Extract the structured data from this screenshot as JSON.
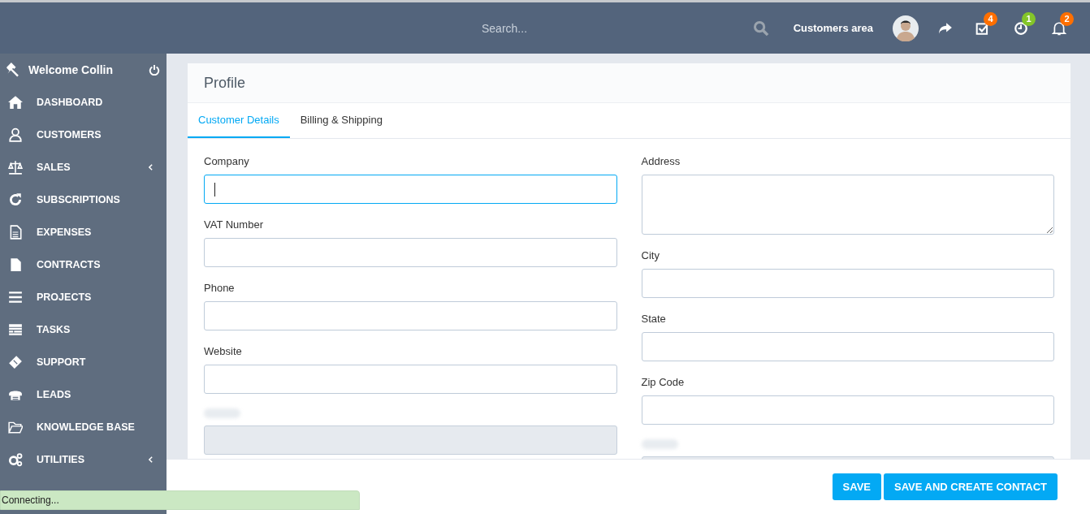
{
  "header": {
    "search": {
      "placeholder": "Search..."
    },
    "customers_area": "Customers area",
    "notifications": [
      {
        "kind": "tasks",
        "count": "4",
        "color": "#ff6f00"
      },
      {
        "kind": "clock",
        "count": "1",
        "color": "#84c529"
      },
      {
        "kind": "bell",
        "count": "2",
        "color": "#ff6f00"
      }
    ]
  },
  "sidebar": {
    "welcome": "Welcome Collin",
    "items": [
      {
        "label": "DASHBOARD",
        "kind": "home",
        "submenu": false
      },
      {
        "label": "CUSTOMERS",
        "kind": "user",
        "submenu": false
      },
      {
        "label": "SALES",
        "kind": "scale",
        "submenu": true
      },
      {
        "label": "SUBSCRIPTIONS",
        "kind": "refresh",
        "submenu": false
      },
      {
        "label": "EXPENSES",
        "kind": "doclines",
        "submenu": false
      },
      {
        "label": "CONTRACTS",
        "kind": "doc",
        "submenu": false
      },
      {
        "label": "PROJECTS",
        "kind": "bars",
        "submenu": false
      },
      {
        "label": "TASKS",
        "kind": "tasks",
        "submenu": false
      },
      {
        "label": "SUPPORT",
        "kind": "ticket",
        "submenu": false
      },
      {
        "label": "LEADS",
        "kind": "phone",
        "submenu": false
      },
      {
        "label": "KNOWLEDGE BASE",
        "kind": "folder",
        "submenu": false
      },
      {
        "label": "UTILITIES",
        "kind": "gears",
        "submenu": true
      }
    ]
  },
  "profile": {
    "title": "Profile",
    "tabs": [
      {
        "label": "Customer Details",
        "selected": true
      },
      {
        "label": "Billing & Shipping",
        "selected": false
      }
    ],
    "left_fields": [
      {
        "label": "Company",
        "kind": "input",
        "focused": true,
        "disabled": false
      },
      {
        "label": "VAT Number",
        "kind": "input",
        "focused": false,
        "disabled": false
      },
      {
        "label": "Phone",
        "kind": "input",
        "focused": false,
        "disabled": false
      },
      {
        "label": "Website",
        "kind": "input",
        "focused": false,
        "disabled": false
      },
      {
        "kind": "input",
        "focused": false,
        "disabled": true
      }
    ],
    "right_fields": [
      {
        "label": "Address",
        "kind": "textarea",
        "focused": false,
        "disabled": false
      },
      {
        "label": "City",
        "kind": "input",
        "focused": false,
        "disabled": false
      },
      {
        "label": "State",
        "kind": "input",
        "focused": false,
        "disabled": false
      },
      {
        "label": "Zip Code",
        "kind": "input",
        "focused": false,
        "disabled": false
      },
      {
        "kind": "input",
        "focused": false,
        "disabled": true
      }
    ]
  },
  "footer": {
    "buttons": [
      "SAVE",
      "SAVE AND CREATE CONTACT"
    ]
  },
  "status_bar": "Connecting..."
}
